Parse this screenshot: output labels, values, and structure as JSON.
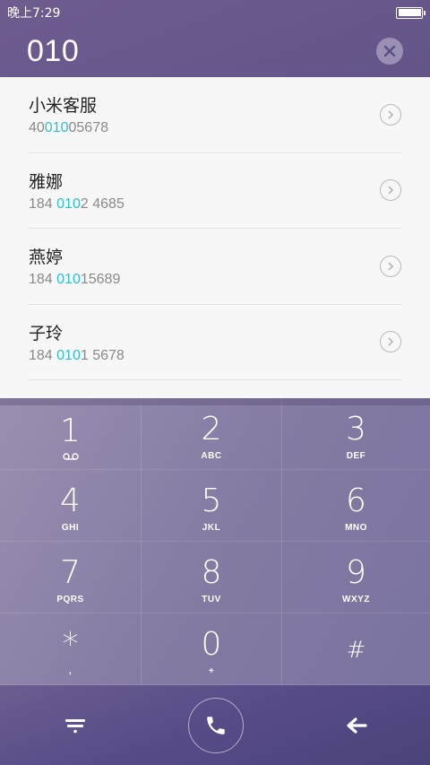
{
  "status_bar": {
    "time": "晚上7:29",
    "battery_icon": "battery-full-icon"
  },
  "dial": {
    "number": "010",
    "clear_icon": "clear-icon"
  },
  "contacts": [
    {
      "name": "小米客服",
      "pre": "40",
      "hl": "010",
      "post": "05678"
    },
    {
      "name": "雅娜",
      "pre": "184 ",
      "hl": "010",
      "post": "2 4685"
    },
    {
      "name": "燕婷",
      "pre": "184 ",
      "hl": "010",
      "post": "15689"
    },
    {
      "name": "子玲",
      "pre": "184 ",
      "hl": "010",
      "post": "1 5678"
    }
  ],
  "keypad": [
    {
      "digit": "1",
      "letters": ""
    },
    {
      "digit": "2",
      "letters": "ABC"
    },
    {
      "digit": "3",
      "letters": "DEF"
    },
    {
      "digit": "4",
      "letters": "GHI"
    },
    {
      "digit": "5",
      "letters": "JKL"
    },
    {
      "digit": "6",
      "letters": "MNO"
    },
    {
      "digit": "7",
      "letters": "PQRS"
    },
    {
      "digit": "8",
      "letters": "TUV"
    },
    {
      "digit": "9",
      "letters": "WXYZ"
    },
    {
      "digit": "*",
      "letters": ","
    },
    {
      "digit": "0",
      "letters": "+"
    },
    {
      "digit": "#",
      "letters": ""
    }
  ],
  "bottom_bar": {
    "menu_icon": "menu-icon",
    "call_icon": "phone-icon",
    "back_icon": "backspace-arrow-icon"
  },
  "colors": {
    "highlight": "#2cc0cc",
    "list_bg": "#f7f7f7",
    "header_bg": "#5c4f86"
  }
}
